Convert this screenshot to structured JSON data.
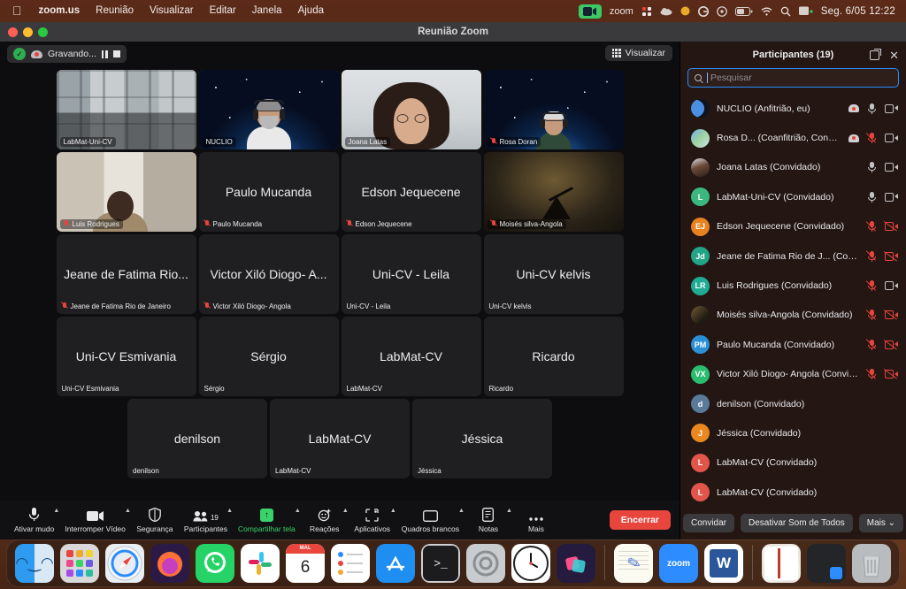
{
  "menubar": {
    "apple": "",
    "items": [
      "zoom.us",
      "Reunião",
      "Visualizar",
      "Editar",
      "Janela",
      "Ajuda"
    ],
    "status": {
      "camera_indicator": "camera-on-icon",
      "app_name": "zoom",
      "icons": [
        "slack-icon",
        "cloud-icon",
        "dot-orange-icon",
        "grammarly-icon",
        "timemachine-icon",
        "battery-icon",
        "wifi-icon",
        "search-icon",
        "controlcenter-icon"
      ],
      "clock": "Seg. 6/05 12:22"
    }
  },
  "window": {
    "title": "Reunião Zoom"
  },
  "meeting": {
    "recording_label": "Gravando...",
    "view_button": "Visualizar",
    "tiles": [
      [
        {
          "name": "LabMat-Uni-CV",
          "display": "",
          "kind": "video-office",
          "muted": false,
          "active": false
        },
        {
          "name": "NUCLIO",
          "display": "",
          "kind": "video-space-person",
          "muted": false,
          "active": true
        },
        {
          "name": "Joana Latas",
          "display": "",
          "kind": "video-joana",
          "muted": false,
          "active": false
        },
        {
          "name": "Rosa Doran",
          "display": "",
          "kind": "video-space-rosa",
          "muted": true,
          "active": false
        }
      ],
      [
        {
          "name": "Luis Rodrigues",
          "display": "",
          "kind": "video-luis",
          "muted": true,
          "active": false
        },
        {
          "name": "Paulo Mucanda",
          "display": "Paulo Mucanda",
          "kind": "name",
          "muted": true,
          "active": false
        },
        {
          "name": "Edson Jequecene",
          "display": "Edson Jequecene",
          "kind": "name",
          "muted": true,
          "active": false
        },
        {
          "name": "Moisés silva-Angola",
          "display": "",
          "kind": "video-telescope",
          "muted": true,
          "active": false
        }
      ],
      [
        {
          "name": "Jeane de Fatima Rio de Janeiro",
          "display": "Jeane de Fatima Rio...",
          "kind": "name",
          "muted": true,
          "active": false
        },
        {
          "name": "Victor Xiló Diogo- Angola",
          "display": "Victor Xiló Diogo- A...",
          "kind": "name",
          "muted": true,
          "active": false
        },
        {
          "name": "Uni-CV - Leila",
          "display": "Uni-CV - Leila",
          "kind": "name",
          "muted": false,
          "active": false
        },
        {
          "name": "Uni-CV kelvis",
          "display": "Uni-CV kelvis",
          "kind": "name",
          "muted": false,
          "active": false
        }
      ],
      [
        {
          "name": "Uni-CV Esmivania",
          "display": "Uni-CV Esmivania",
          "kind": "name",
          "muted": false,
          "active": false
        },
        {
          "name": "Sérgio",
          "display": "Sérgio",
          "kind": "name",
          "muted": false,
          "active": false
        },
        {
          "name": "LabMat-CV",
          "display": "LabMat-CV",
          "kind": "name",
          "muted": false,
          "active": false
        },
        {
          "name": "Ricardo",
          "display": "Ricardo",
          "kind": "name",
          "muted": false,
          "active": false
        }
      ],
      [
        {
          "name": "denilson",
          "display": "denilson",
          "kind": "name",
          "muted": false,
          "active": false
        },
        {
          "name": "LabMat-CV",
          "display": "LabMat-CV",
          "kind": "name",
          "muted": false,
          "active": false
        },
        {
          "name": "Jéssica",
          "display": "Jéssica",
          "kind": "name",
          "muted": false,
          "active": false
        }
      ]
    ]
  },
  "toolbar": {
    "items": [
      {
        "label": "Ativar mudo",
        "icon": "microphone-icon",
        "caret": true
      },
      {
        "label": "Interromper Vídeo",
        "icon": "video-camera-icon",
        "caret": true
      },
      {
        "label": "Segurança",
        "icon": "shield-icon",
        "caret": false
      },
      {
        "label": "Participantes",
        "icon": "people-icon",
        "caret": true,
        "count": "19"
      },
      {
        "label": "Compartilhar tela",
        "icon": "share-screen-icon",
        "caret": true
      },
      {
        "label": "Reações",
        "icon": "reactions-icon",
        "caret": true
      },
      {
        "label": "Aplicativos",
        "icon": "apps-icon",
        "caret": true
      },
      {
        "label": "Quadros brancos",
        "icon": "whiteboard-icon",
        "caret": true
      },
      {
        "label": "Notas",
        "icon": "notes-icon",
        "caret": true
      },
      {
        "label": "Mais",
        "icon": "more-icon",
        "caret": false
      }
    ],
    "end_button": "Encerrar"
  },
  "panel": {
    "title": "Participantes (19)",
    "search_placeholder": "Pesquisar",
    "search_value": "",
    "participants": [
      {
        "name": "NUCLIO (Anfitrião, eu)",
        "avatar": "moon",
        "initials": "",
        "color": "",
        "recording": true,
        "mic": "on",
        "cam": "on"
      },
      {
        "name": "Rosa D...   (Coanfitrião, Convidado)",
        "avatar": "photo-rosa",
        "initials": "",
        "color": "",
        "recording": true,
        "mic": "muted",
        "cam": "on"
      },
      {
        "name": "Joana Latas (Convidado)",
        "avatar": "photo-joana",
        "initials": "",
        "color": "",
        "recording": false,
        "mic": "on",
        "cam": "on"
      },
      {
        "name": "LabMat-Uni-CV (Convidado)",
        "avatar": "initials",
        "initials": "L",
        "color": "#3ab87f",
        "recording": false,
        "mic": "on",
        "cam": "on"
      },
      {
        "name": "Edson Jequecene (Convidado)",
        "avatar": "initials",
        "initials": "EJ",
        "color": "#e8811f",
        "recording": false,
        "mic": "muted",
        "cam": "off"
      },
      {
        "name": "Jeane de Fatima Rio de J... (Convidado)",
        "avatar": "initials",
        "initials": "Jd",
        "color": "#22a587",
        "recording": false,
        "mic": "muted",
        "cam": "off"
      },
      {
        "name": "Luis Rodrigues (Convidado)",
        "avatar": "initials",
        "initials": "LR",
        "color": "#21ab95",
        "recording": false,
        "mic": "muted",
        "cam": "on"
      },
      {
        "name": "Moisés silva-Angola (Convidado)",
        "avatar": "photo-moises",
        "initials": "",
        "color": "",
        "recording": false,
        "mic": "muted",
        "cam": "off"
      },
      {
        "name": "Paulo Mucanda (Convidado)",
        "avatar": "initials",
        "initials": "PM",
        "color": "#2b8fd6",
        "recording": false,
        "mic": "muted",
        "cam": "off"
      },
      {
        "name": "Victor Xiló Diogo- Angola (Convidado)",
        "avatar": "initials",
        "initials": "VX",
        "color": "#2bbd6e",
        "recording": false,
        "mic": "muted",
        "cam": "off"
      },
      {
        "name": "denilson (Convidado)",
        "avatar": "initials",
        "initials": "d",
        "color": "#5a7a9a",
        "recording": false,
        "mic": "none",
        "cam": "none"
      },
      {
        "name": "Jéssica (Convidado)",
        "avatar": "initials",
        "initials": "J",
        "color": "#e8881f",
        "recording": false,
        "mic": "none",
        "cam": "none"
      },
      {
        "name": "LabMat-CV (Convidado)",
        "avatar": "initials",
        "initials": "L",
        "color": "#e1554a",
        "recording": false,
        "mic": "none",
        "cam": "none"
      },
      {
        "name": "LabMat-CV (Convidado)",
        "avatar": "initials",
        "initials": "L",
        "color": "#e1554a",
        "recording": false,
        "mic": "none",
        "cam": "none"
      }
    ],
    "footer": {
      "invite": "Convidar",
      "mute_all": "Desativar Som de Todos",
      "more": "Mais ⌄"
    }
  },
  "dock": {
    "items": [
      {
        "name": "finder",
        "glyph": "🙂",
        "bg": "#2e9bf0",
        "running": true
      },
      {
        "name": "launchpad",
        "glyph": "▦",
        "bg": "#d8d8da",
        "running": false
      },
      {
        "name": "safari",
        "glyph": "🧭",
        "bg": "#e9eef2",
        "running": false
      },
      {
        "name": "firefox",
        "glyph": "🦊",
        "bg": "#2b1a45",
        "running": true
      },
      {
        "name": "whatsapp",
        "glyph": "✆",
        "bg": "#25d366",
        "running": true
      },
      {
        "name": "slack",
        "glyph": "#",
        "bg": "#ffffff",
        "running": false
      },
      {
        "name": "calendar",
        "glyph": "6",
        "bg": "#ffffff",
        "running": false,
        "top": "MAL"
      },
      {
        "name": "reminders",
        "glyph": "≡",
        "bg": "#ffffff",
        "running": false
      },
      {
        "name": "app-store",
        "glyph": "A",
        "bg": "#1e8ef0",
        "running": false
      },
      {
        "name": "terminal",
        "glyph": ">_",
        "bg": "#1c1c1e",
        "running": false
      },
      {
        "name": "system-settings",
        "glyph": "⚙",
        "bg": "#c9ccce",
        "running": false
      },
      {
        "name": "clock",
        "glyph": "◷",
        "bg": "#ffffff",
        "running": false
      },
      {
        "name": "shortcuts",
        "glyph": "◆",
        "bg": "#241b3e",
        "running": false
      },
      {
        "name": "separator",
        "glyph": "",
        "bg": "",
        "running": false
      },
      {
        "name": "notes",
        "glyph": "✎",
        "bg": "#fbfbf2",
        "running": true
      },
      {
        "name": "zoom",
        "glyph": "zoom",
        "bg": "#2d8cff",
        "running": true
      },
      {
        "name": "word",
        "glyph": "W",
        "bg": "#ffffff",
        "running": true
      },
      {
        "name": "separator",
        "glyph": "",
        "bg": "",
        "running": false
      },
      {
        "name": "documents-stack",
        "glyph": "▤",
        "bg": "#e8e4dc",
        "running": false
      },
      {
        "name": "downloads-stack",
        "glyph": "▤",
        "bg": "#232528",
        "running": false
      },
      {
        "name": "trash",
        "glyph": "🗑",
        "bg": "#b9bcbe",
        "running": false
      }
    ]
  }
}
